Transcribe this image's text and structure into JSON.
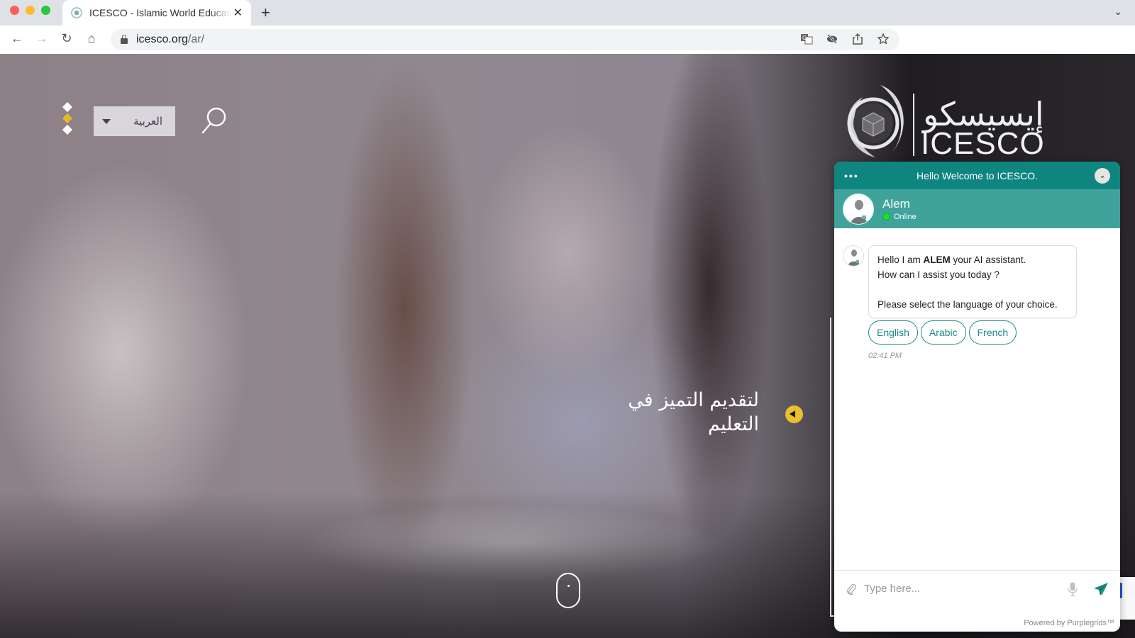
{
  "browser": {
    "tab": {
      "title": "ICESCO - Islamic World Educational, Scientific and Cultural Organization"
    },
    "url": {
      "host": "icesco.org",
      "path": "/ar/"
    },
    "icons": {
      "back": "←",
      "forward": "→",
      "reload": "↻",
      "home": "⌂",
      "close_tab": "✕",
      "new_tab": "+",
      "tab_menu": "⌄",
      "translate": "G",
      "tracking": "◉",
      "share": "⇪",
      "bookmark": "☆"
    }
  },
  "header": {
    "language_select": {
      "selected": "العربية"
    },
    "logo": {
      "arabic": "إيسيسكو",
      "latin": "ICESCO"
    }
  },
  "hero": {
    "slide_text": "لتقديم التميز في التعليم",
    "accent_color": "#e8c12c"
  },
  "chat": {
    "header_title": "Hello Welcome to ICESCO.",
    "menu_label": "•••",
    "minimize_label": "⌄",
    "agent": {
      "name": "Alem",
      "status": "Online"
    },
    "message": {
      "line1_prefix": "Hello I am ",
      "line1_bold": "ALEM",
      "line1_suffix": " your AI assistant.",
      "line2": "How can I assist you today ?",
      "line3": "Please select the language of your choice."
    },
    "quick_replies": [
      {
        "label": "English"
      },
      {
        "label": "Arabic"
      },
      {
        "label": "French"
      }
    ],
    "timestamp": "02:41 PM",
    "input": {
      "placeholder": "Type here...",
      "value": ""
    },
    "powered_by": "Powered by Purplegrids™",
    "brand_color": "#0f8580"
  }
}
